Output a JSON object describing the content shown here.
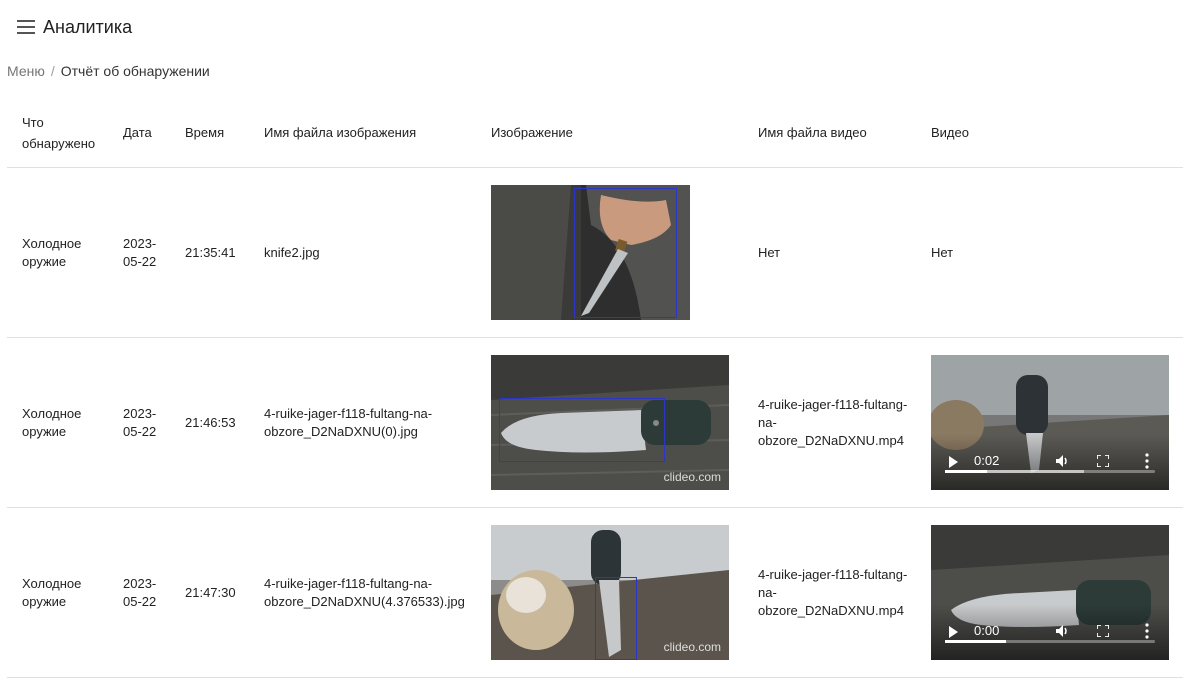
{
  "app": {
    "title": "Аналитика",
    "menu_icon": "hamburger-menu-icon"
  },
  "breadcrumb": {
    "root": "Меню",
    "separator": "/",
    "current": "Отчёт об обнаружении"
  },
  "table": {
    "headers": [
      "Что обнаружено",
      "Дата",
      "Время",
      "Имя файла изображения",
      "Изображение",
      "Имя файла видео",
      "Видео"
    ],
    "rows": [
      {
        "type": "Холодное оружие",
        "date": "2023-05-22",
        "time": "21:35:41",
        "image_file": "knife2.jpg",
        "video_file": "Нет",
        "video": "Нет"
      },
      {
        "type": "Холодное оружие",
        "date": "2023-05-22",
        "time": "21:46:53",
        "image_file": "4-ruike-jager-f118-fultang-na-obzore_D2NaDXNU(0).jpg",
        "image_watermark": "clideo.com",
        "video_file": "4-ruike-jager-f118-fultang-na-obzore_D2NaDXNU.mp4",
        "video_time": "0:02",
        "video_progress": 0.2,
        "video_buffered": 0.66
      },
      {
        "type": "Холодное оружие",
        "date": "2023-05-22",
        "time": "21:47:30",
        "image_file": "4-ruike-jager-f118-fultang-na-obzore_D2NaDXNU(4.376533).jpg",
        "image_watermark": "clideo.com",
        "video_file": "4-ruike-jager-f118-fultang-na-obzore_D2NaDXNU.mp4",
        "video_time": "0:00",
        "video_progress": 0.29,
        "video_buffered": 0.29
      }
    ]
  },
  "colors": {
    "detection_box": "#2b35c8",
    "divider": "#e0e0e0"
  }
}
